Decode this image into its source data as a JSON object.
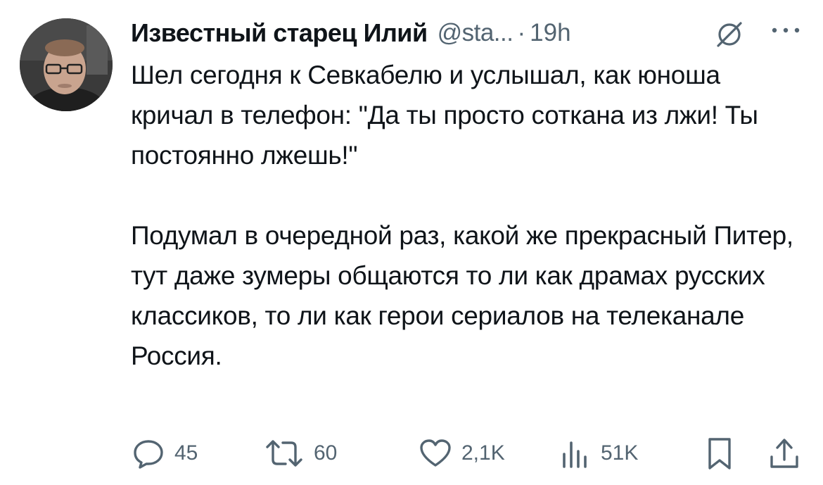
{
  "author": {
    "name": "Известный старец Илий",
    "handle": "@sta...",
    "separator": "·",
    "time": "19h"
  },
  "icons": {
    "badge": "grok-icon",
    "more": "more-icon",
    "reply": "reply-icon",
    "retweet": "retweet-icon",
    "like": "heart-icon",
    "views": "views-icon",
    "bookmark": "bookmark-icon",
    "share": "share-icon"
  },
  "tweet": {
    "paragraphs": [
      "Шел сегодня к Севкабелю и услышал, как юноша кричал в телефон: \"Да ты просто соткана из лжи! Ты постоянно лжешь!\"",
      "Подумал в очередной раз, какой же прекрасный Питер, тут даже зумеры общаются то ли как драмах русских классиков, то ли как герои сериалов на телеканале Россия."
    ]
  },
  "actions": {
    "reply_count": "45",
    "retweet_count": "60",
    "like_count": "2,1K",
    "views_count": "51K"
  },
  "colors": {
    "text": "#0f1419",
    "secondary": "#536471",
    "background": "#ffffff"
  }
}
